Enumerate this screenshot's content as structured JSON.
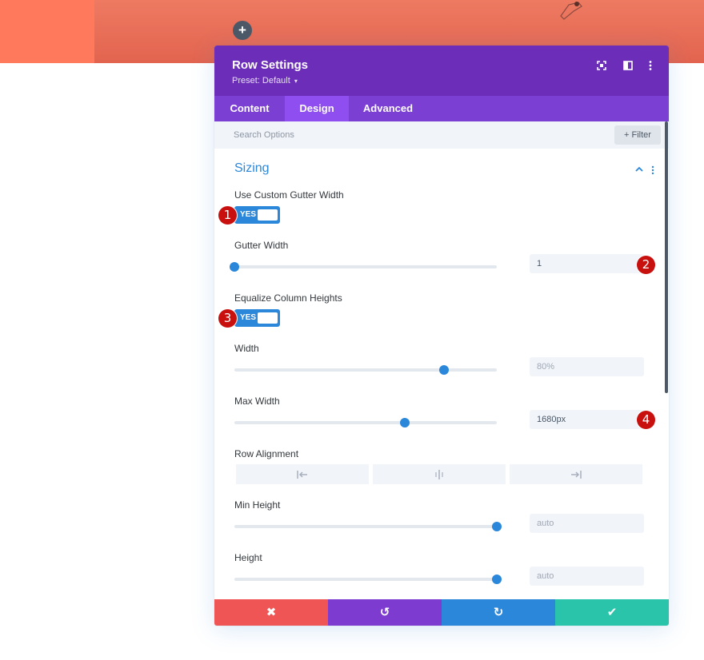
{
  "app": {
    "add_button_glyph": "+"
  },
  "modal": {
    "title": "Row Settings",
    "preset_label": "Preset: Default",
    "preset_caret": "▾",
    "header_icons": [
      "fullscreen-icon",
      "split-view-icon",
      "more-options-icon"
    ]
  },
  "tabs": [
    {
      "label": "Content",
      "active": false
    },
    {
      "label": "Design",
      "active": true
    },
    {
      "label": "Advanced",
      "active": false
    }
  ],
  "search": {
    "placeholder": "Search Options",
    "filter_label": "Filter",
    "filter_glyph": "+"
  },
  "section": {
    "title": "Sizing"
  },
  "fields": {
    "custom_gutter": {
      "label": "Use Custom Gutter Width",
      "value": "YES"
    },
    "gutter_width": {
      "label": "Gutter Width",
      "value": "1",
      "slider_fraction": 0.0
    },
    "equalize_heights": {
      "label": "Equalize Column Heights",
      "value": "YES"
    },
    "width": {
      "label": "Width",
      "value": "80%",
      "slider_fraction": 0.8
    },
    "max_width": {
      "label": "Max Width",
      "value": "1680px",
      "slider_fraction": 0.65
    },
    "row_alignment": {
      "label": "Row Alignment",
      "options": [
        "left",
        "center",
        "right"
      ]
    },
    "min_height": {
      "label": "Min Height",
      "value": "auto",
      "slider_fraction": 1.0
    },
    "height": {
      "label": "Height",
      "value": "auto",
      "slider_fraction": 1.0
    }
  },
  "markers": [
    "1",
    "2",
    "3",
    "4"
  ],
  "footer": {
    "buttons": [
      {
        "name": "cancel",
        "glyph": "✖",
        "color": "#ef5555"
      },
      {
        "name": "undo",
        "glyph": "↺",
        "color": "#7e3bd0"
      },
      {
        "name": "redo",
        "glyph": "↻",
        "color": "#2b87da"
      },
      {
        "name": "save",
        "glyph": "✔",
        "color": "#29c4a9"
      }
    ]
  },
  "colors": {
    "header": "#6c2eb9",
    "tabs": "#7b3fd4",
    "active_tab": "#8f4ef0",
    "accent": "#2b87da",
    "marker": "#c8100f",
    "hero": "#e2644f"
  }
}
